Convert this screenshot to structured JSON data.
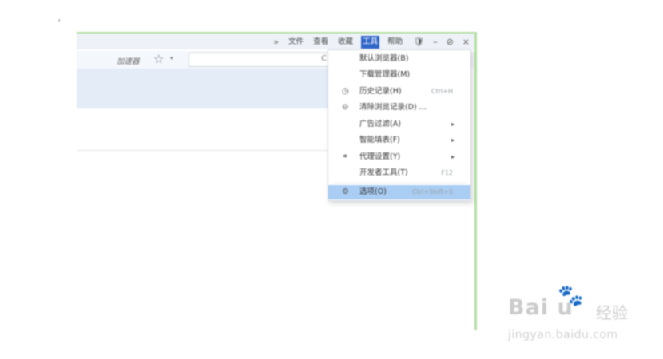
{
  "titlebar": {
    "chevron": "»",
    "menus": [
      "文件",
      "查看",
      "收藏",
      "工具",
      "帮助"
    ],
    "active_menu": "工具",
    "controls": {
      "shield": "🛡",
      "minimize": "–",
      "restore": "⊘",
      "close": "×"
    }
  },
  "toolbar": {
    "accelerator_label": "加速器",
    "star_icon": "☆",
    "dropdown_caret": "▾",
    "address_glyph": "C"
  },
  "tools_menu": {
    "items": [
      {
        "label": "默认浏览器(B)",
        "icon": "",
        "shortcut": "",
        "submenu": false
      },
      {
        "label": "下载管理器(M)",
        "icon": "",
        "shortcut": "",
        "submenu": false
      },
      {
        "label": "历史记录(H)",
        "icon": "◷",
        "shortcut": "Ctrl+H",
        "submenu": false
      },
      {
        "label": "清除浏览记录(D) ...",
        "icon": "⊖",
        "shortcut": "",
        "submenu": false
      },
      {
        "label": "广告过滤(A)",
        "icon": "",
        "shortcut": "",
        "submenu": true
      },
      {
        "label": "智能填表(F)",
        "icon": "",
        "shortcut": "",
        "submenu": true
      },
      {
        "label": "代理设置(Y)",
        "icon": "⚭",
        "shortcut": "",
        "submenu": true
      },
      {
        "label": "开发者工具(T)",
        "icon": "",
        "shortcut": "F12",
        "submenu": false
      }
    ],
    "options_item": {
      "label": "选项(O)",
      "icon": "⚙",
      "shortcut": "Ctrl+Shift+S"
    },
    "submenu_arrow": "▸"
  },
  "watermark": {
    "brand": "Bai  u",
    "paw": "🐾",
    "jingyan": "经验",
    "url": "jingyan.baidu.com"
  },
  "colors": {
    "window_border": "#b6e0a6",
    "active_menu_bg": "#2f66c8",
    "highlight_row": "#a9cdf3"
  }
}
